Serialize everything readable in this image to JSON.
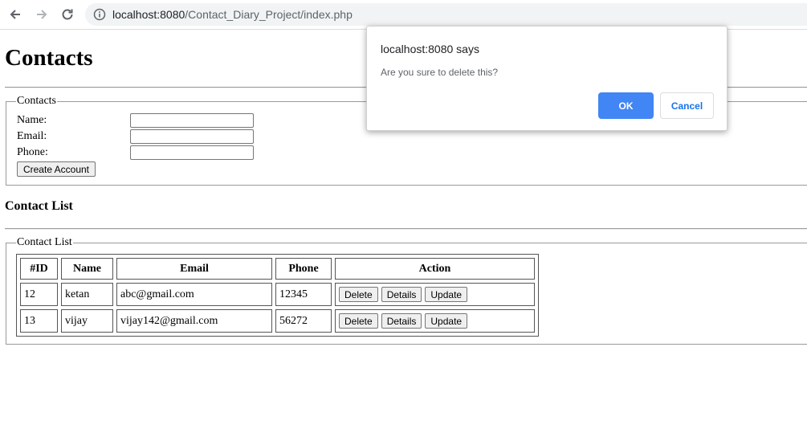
{
  "browser": {
    "url_host": "localhost:8080",
    "url_path": "/Contact_Diary_Project/index.php"
  },
  "page": {
    "title": "Contacts",
    "form": {
      "legend": "Contacts",
      "name_label": "Name:",
      "email_label": "Email:",
      "phone_label": "Phone:",
      "name_value": "",
      "email_value": "",
      "phone_value": "",
      "create_button": "Create Account"
    },
    "list_heading": "Contact List",
    "list_legend": "Contact List",
    "table": {
      "headers": [
        "#ID",
        "Name",
        "Email",
        "Phone",
        "Action"
      ],
      "rows": [
        {
          "id": "12",
          "name": "ketan",
          "email": "abc@gmail.com",
          "phone": "12345"
        },
        {
          "id": "13",
          "name": "vijay",
          "email": "vijay142@gmail.com",
          "phone": "56272"
        }
      ],
      "delete_label": "Delete",
      "details_label": "Details",
      "update_label": "Update"
    }
  },
  "dialog": {
    "title": "localhost:8080 says",
    "message": "Are you sure to delete this?",
    "ok": "OK",
    "cancel": "Cancel"
  }
}
